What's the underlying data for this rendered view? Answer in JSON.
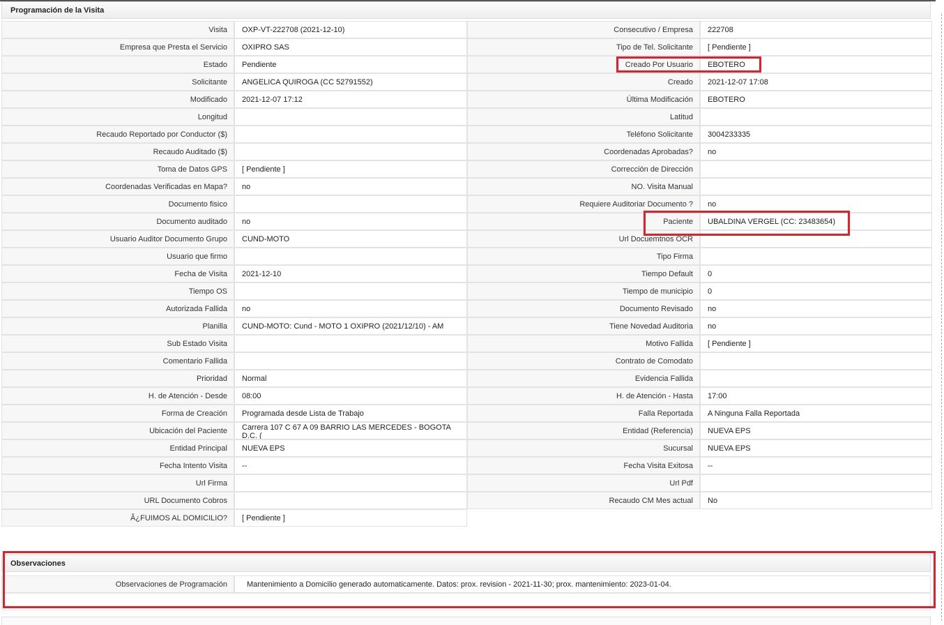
{
  "section1": {
    "title": "Programación de la Visita"
  },
  "rows": [
    {
      "l1": "Visita",
      "v1": "OXP-VT-222708 (2021-12-10)",
      "l2": "Consecutivo / Empresa",
      "v2": "222708"
    },
    {
      "l1": "Empresa que Presta el Servicio",
      "v1": "OXIPRO SAS",
      "l2": "Tipo de Tel. Solicitante",
      "v2": "[ Pendiente ]"
    },
    {
      "l1": "Estado",
      "v1": "Pendiente",
      "l2": "Creado Por Usuario",
      "v2": "EBOTERO"
    },
    {
      "l1": "Solicitante",
      "v1": "ANGELICA QUIROGA (CC 52791552)",
      "l2": "Creado",
      "v2": "2021-12-07 17:08"
    },
    {
      "l1": "Modificado",
      "v1": "2021-12-07 17:12",
      "l2": "Última Modificación",
      "v2": " EBOTERO"
    },
    {
      "l1": "Longitud",
      "v1": "",
      "l2": "Latitud",
      "v2": ""
    },
    {
      "l1": "Recaudo Reportado por Conductor ($)",
      "v1": "",
      "l2": "Teléfono Solicitante",
      "v2": "3004233335"
    },
    {
      "l1": "Recaudo Auditado ($)",
      "v1": "",
      "l2": "Coordenadas Aprobadas?",
      "v2": " no"
    },
    {
      "l1": "Toma de Datos GPS",
      "v1": "[ Pendiente ]",
      "l2": "Corrección de Dirección",
      "v2": ""
    },
    {
      "l1": "Coordenadas Verificadas en Mapa?",
      "v1": " no",
      "l2": "NO. Visita Manual",
      "v2": ""
    },
    {
      "l1": "Documento fisico",
      "v1": "",
      "l2": "Requiere Auditoriar Documento ?",
      "v2": " no"
    },
    {
      "l1": "Documento auditado",
      "v1": " no",
      "l2": "Paciente",
      "v2": "UBALDINA VERGEL (CC: 23483654)"
    },
    {
      "l1": "Usuario Auditor Documento Grupo",
      "v1": "CUND-MOTO",
      "l2": "Url Docuemtnos OCR",
      "v2": ""
    },
    {
      "l1": "Usuario que firmo",
      "v1": "",
      "l2": "Tipo Firma",
      "v2": ""
    },
    {
      "l1": "Fecha de Visita",
      "v1": " 2021-12-10",
      "l2": "Tiempo Default",
      "v2": " 0"
    },
    {
      "l1": "Tiempo OS",
      "v1": "",
      "l2": "Tiempo de municipio",
      "v2": " 0"
    },
    {
      "l1": "Autorizada Fallida",
      "v1": " no",
      "l2": "Documento Revisado",
      "v2": " no"
    },
    {
      "l1": "Planilla",
      "v1": "CUND-MOTO: Cund - MOTO 1 OXIPRO (2021/12/10) - AM",
      "l2": "Tiene Novedad Auditoria",
      "v2": " no"
    },
    {
      "l1": "Sub Estado Visita",
      "v1": "",
      "l2": "Motivo Fallida",
      "v2": "[ Pendiente ]"
    },
    {
      "l1": "Comentario Fallida",
      "v1": "",
      "l2": "Contrato de Comodato",
      "v2": ""
    },
    {
      "l1": "Prioridad",
      "v1": "Normal",
      "l2": "Evidencia Fallida",
      "v2": ""
    },
    {
      "l1": "H. de Atención - Desde",
      "v1": "08:00",
      "l2": "H. de Atención - Hasta",
      "v2": "17:00"
    },
    {
      "l1": "Forma de Creación",
      "v1": "Programada desde Lista de Trabajo",
      "l2": "Falla Reportada",
      "v2": "A Ninguna Falla Reportada"
    },
    {
      "l1": "Ubicación del Paciente",
      "v1": "Carrera 107 C 67 A 09 BARRIO LAS MERCEDES - BOGOTA D.C. (",
      "l2": "Entidad (Referencia)",
      "v2": "NUEVA EPS"
    },
    {
      "l1": "Entidad Principal",
      "v1": "NUEVA EPS",
      "l2": "Sucursal",
      "v2": "NUEVA EPS"
    },
    {
      "l1": "Fecha Intento Visita",
      "v1": " --",
      "l2": "Fecha Visita Exitosa",
      "v2": " --"
    },
    {
      "l1": "Url Firma",
      "v1": "",
      "l2": "Url Pdf",
      "v2": ""
    },
    {
      "l1": "URL Documento Cobros",
      "v1": "",
      "l2": "Recaudo CM Mes actual",
      "v2": " No"
    }
  ],
  "last_row": {
    "label": "Â¿FUIMOS AL DOMICILIO?",
    "value": "[ Pendiente ]"
  },
  "section2": {
    "title": "Observaciones",
    "label": "Observaciones de Programación",
    "value": "Mantenimiento a Domicilio generado automaticamente. Datos: prox. revision - 2021-11-30; prox. mantenimiento: 2023-01-04."
  },
  "highlight_color": "#e0202a"
}
